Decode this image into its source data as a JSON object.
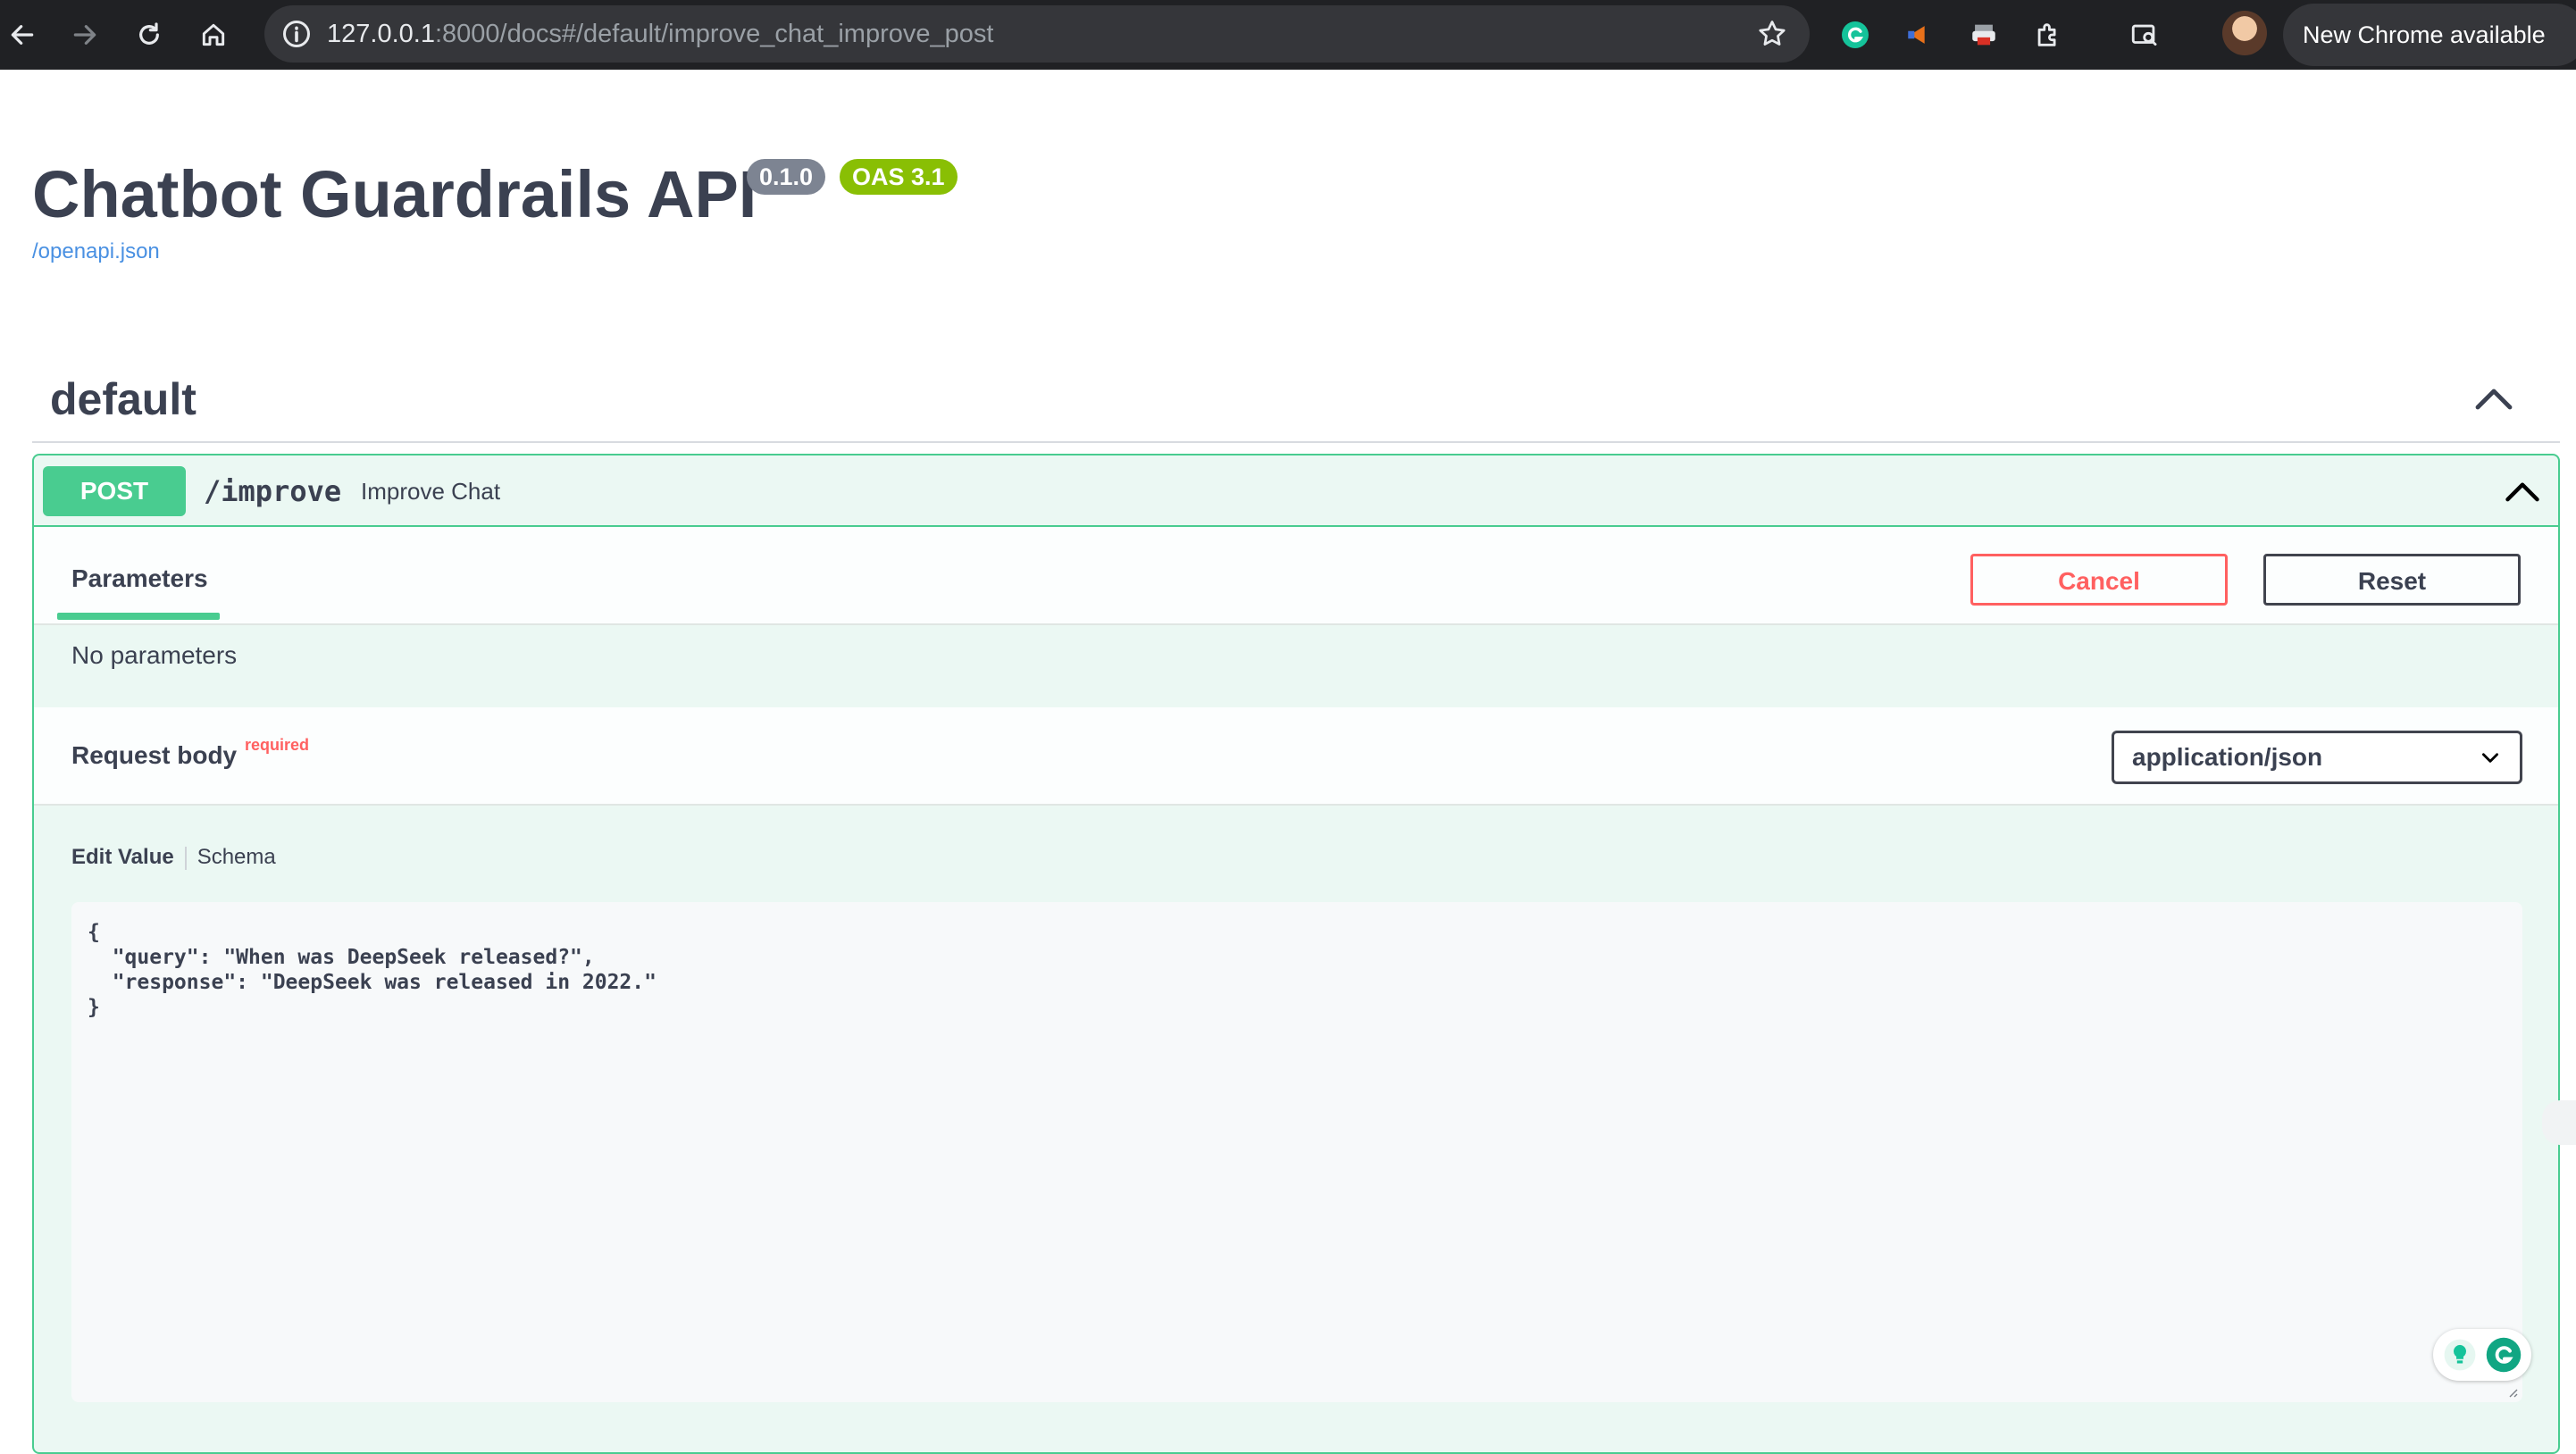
{
  "browser": {
    "url_host": "127.0.0.1",
    "url_rest": ":8000/docs#/default/improve_chat_improve_post",
    "update_label": "New Chrome available"
  },
  "api": {
    "title": "Chatbot Guardrails API",
    "version": "0.1.0",
    "oas": "OAS 3.1",
    "spec_link": "/openapi.json"
  },
  "tag": {
    "name": "default"
  },
  "operation": {
    "method": "POST",
    "path": "/improve",
    "summary": "Improve Chat",
    "parameters_tab": "Parameters",
    "cancel_label": "Cancel",
    "reset_label": "Reset",
    "no_parameters": "No parameters",
    "request_body_title": "Request body",
    "required_label": "required",
    "content_type": "application/json",
    "edit_value_tab": "Edit Value",
    "schema_tab": "Schema",
    "body_json": "{\n  \"query\": \"When was DeepSeek released?\",\n  \"response\": \"DeepSeek was released in 2022.\"\n}"
  },
  "colors": {
    "post": "#49cc90",
    "cancel": "#ff6060",
    "link": "#4990e2",
    "oas_badge": "#89bf04",
    "version_badge": "#7d8492"
  }
}
